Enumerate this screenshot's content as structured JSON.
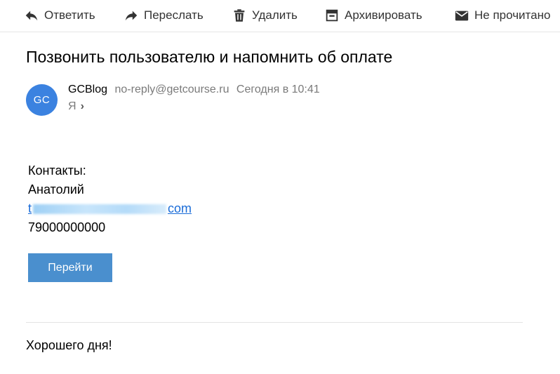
{
  "toolbar": {
    "reply_label": "Ответить",
    "forward_label": "Переслать",
    "delete_label": "Удалить",
    "archive_label": "Архивировать",
    "unread_label": "Не прочитано"
  },
  "message": {
    "subject": "Позвонить пользователю и напомнить об оплате",
    "avatar_initials": "GC",
    "sender_name": "GCBlog",
    "sender_email": "no-reply@getcourse.ru",
    "date": "Сегодня в 10:41",
    "recipient": "Я"
  },
  "body": {
    "contacts_label": "Контакты:",
    "contact_name": "Анатолий",
    "contact_email_start": "t",
    "contact_email_end": "com",
    "contact_phone": "79000000000",
    "button_label": "Перейти",
    "footer": "Хорошего дня!"
  },
  "colors": {
    "avatar": "#3b82e0",
    "button": "#4a8fce",
    "link": "#1a6cd8"
  }
}
